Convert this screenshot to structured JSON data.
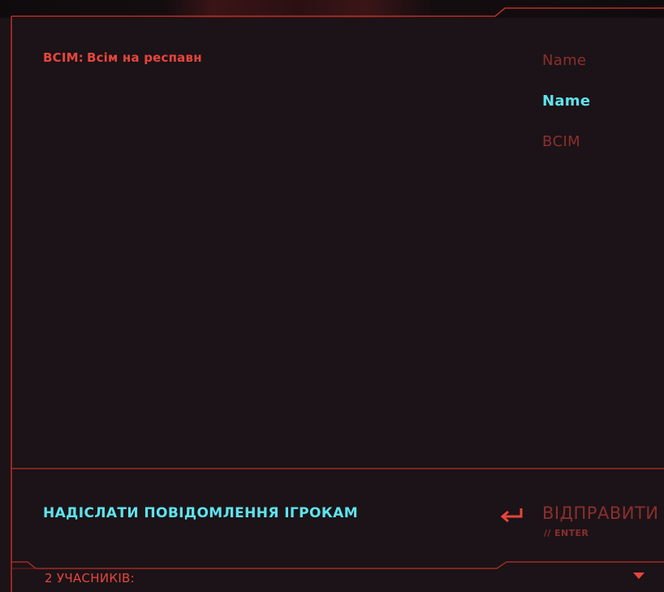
{
  "chat": {
    "messages": [
      {
        "channel": "ВСІМ",
        "separator": ":",
        "text": "Всім на респавн"
      }
    ]
  },
  "recipients": {
    "items": [
      {
        "label": "Name",
        "state": "inactive"
      },
      {
        "label": "Name",
        "state": "selected"
      },
      {
        "label": "ВСІМ",
        "state": "inactive"
      }
    ]
  },
  "compose": {
    "placeholder": "НАДІСЛАТИ ПОВІДОМЛЕННЯ ІГРОКАМ"
  },
  "send": {
    "label": "ВІДПРАВИТИ",
    "hint": "// ENTER",
    "icon": "return-arrow-icon"
  },
  "participants": {
    "label": "2 УЧАСНИКІВ:",
    "icon": "chevron-down-icon"
  },
  "colors": {
    "accent_red": "#e8453c",
    "dim_red": "#8a2f2c",
    "frame_red": "#b8302a",
    "cyan": "#5fe3ee",
    "panel_bg": "#1b1317"
  }
}
